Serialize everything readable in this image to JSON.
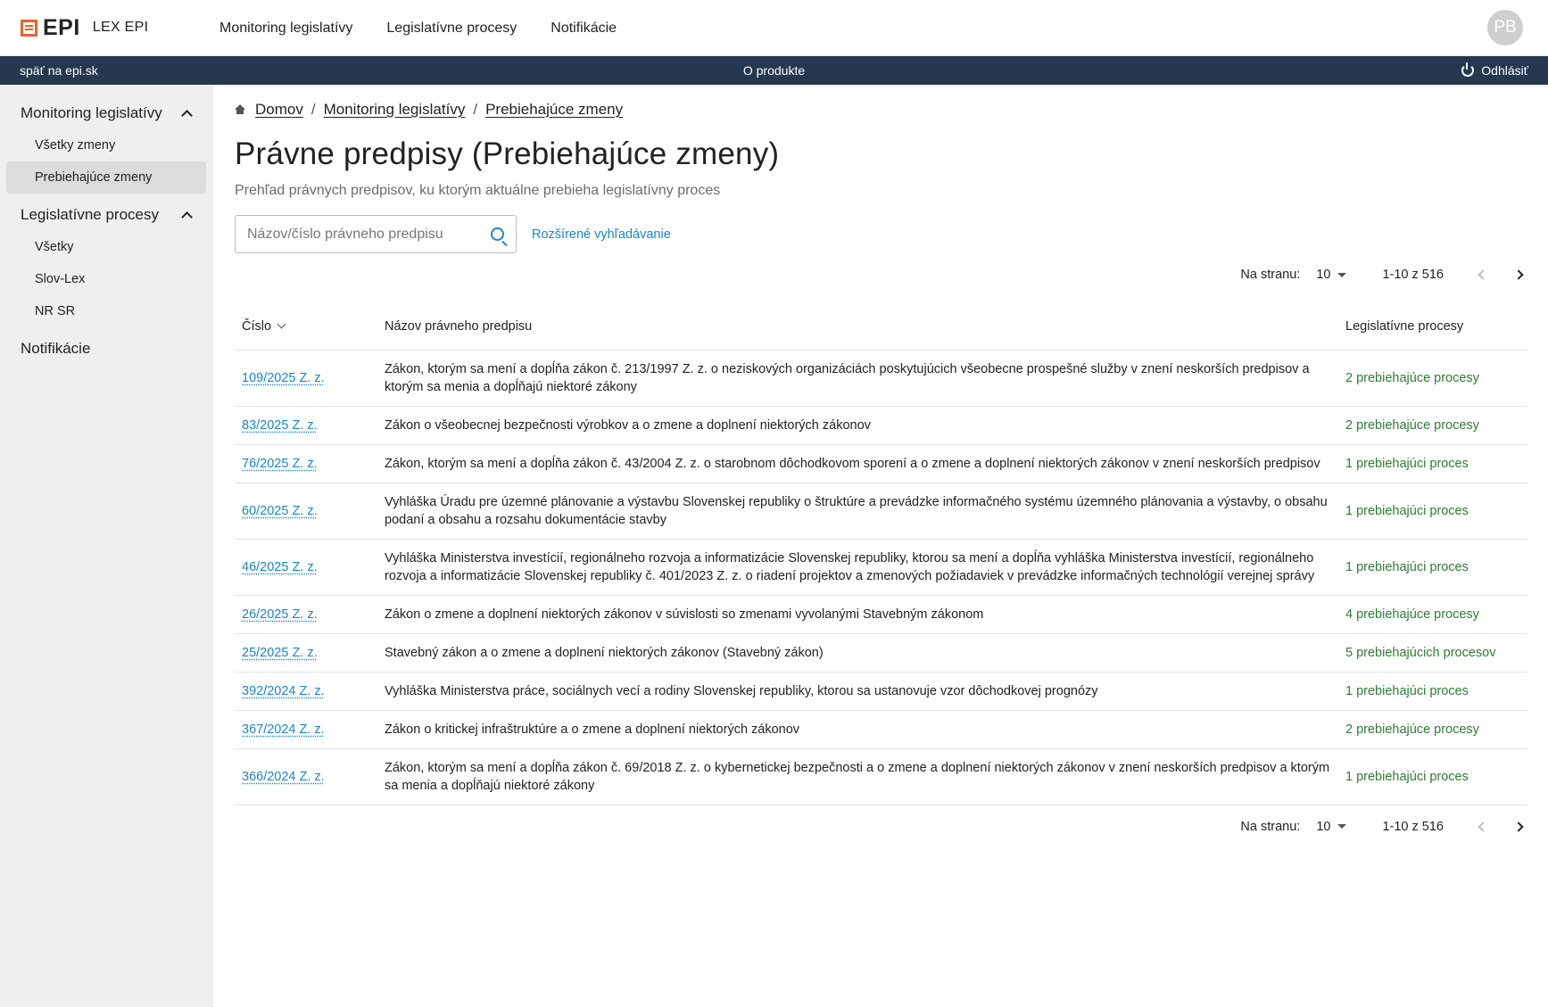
{
  "header": {
    "logo_text": "EPI",
    "product_name": "LEX EPI",
    "nav": [
      "Monitoring legislatívy",
      "Legislatívne procesy",
      "Notifikácie"
    ],
    "avatar_initials": "PB"
  },
  "subbar": {
    "back_link": "späť na epi.sk",
    "about": "O produkte",
    "logout": "Odhlásiť"
  },
  "sidebar": {
    "sections": [
      {
        "label": "Monitoring legislatívy",
        "items": [
          "Všetky zmeny",
          "Prebiehajúce zmeny"
        ]
      },
      {
        "label": "Legislatívne procesy",
        "items": [
          "Všetky",
          "Slov-Lex",
          "NR SR"
        ]
      },
      {
        "label": "Notifikácie",
        "items": []
      }
    ],
    "active_item": "Prebiehajúce zmeny"
  },
  "breadcrumb": [
    "Domov",
    "Monitoring legislatívy",
    "Prebiehajúce zmeny"
  ],
  "page": {
    "title": "Právne predpisy (Prebiehajúce zmeny)",
    "subtitle": "Prehľad právnych predpisov, ku ktorým aktuálne prebieha legislatívny proces"
  },
  "search": {
    "placeholder": "Názov/číslo právneho predpisu",
    "advanced_link": "Rozšírené vyhľadávanie"
  },
  "pagination": {
    "per_page_label": "Na stranu:",
    "per_page_value": "10",
    "range": "1-10 z 516"
  },
  "table": {
    "headers": [
      "Číslo",
      "Názov právneho predpisu",
      "Legislatívne procesy"
    ],
    "rows": [
      {
        "number": "109/2025 Z. z.",
        "title": "Zákon, ktorým sa mení a dopĺňa zákon č. 213/1997 Z. z. o neziskových organizáciách poskytujúcich všeobecne prospešné služby v znení neskorších predpisov a ktorým sa menia a dopĺňajú niektoré zákony",
        "processes": "2 prebiehajúce procesy"
      },
      {
        "number": "83/2025 Z. z.",
        "title": "Zákon o všeobecnej bezpečnosti výrobkov a o zmene a doplnení niektorých zákonov",
        "processes": "2 prebiehajúce procesy"
      },
      {
        "number": "76/2025 Z. z.",
        "title": "Zákon, ktorým sa mení a dopĺňa zákon č. 43/2004 Z. z. o starobnom dôchodkovom sporení a o zmene a doplnení niektorých zákonov v znení neskorších predpisov",
        "processes": "1 prebiehajúci proces"
      },
      {
        "number": "60/2025 Z. z.",
        "title": "Vyhláška Úradu pre územné plánovanie a výstavbu Slovenskej republiky o štruktúre a prevádzke informačného systému územného plánovania a výstavby, o obsahu podaní a obsahu a rozsahu dokumentácie stavby",
        "processes": "1 prebiehajúci proces"
      },
      {
        "number": "46/2025 Z. z.",
        "title": "Vyhláška Ministerstva investícií, regionálneho rozvoja a informatizácie Slovenskej republiky, ktorou sa mení a dopĺňa vyhláška Ministerstva investícií, regionálneho rozvoja a informatizácie Slovenskej republiky č. 401/2023 Z. z. o riadení projektov a zmenových požiadaviek v prevádzke informačných technológií verejnej správy",
        "processes": "1 prebiehajúci proces"
      },
      {
        "number": "26/2025 Z. z.",
        "title": "Zákon o zmene a doplnení niektorých zákonov v súvislosti so zmenami vyvolanými Stavebným zákonom",
        "processes": "4 prebiehajúce procesy"
      },
      {
        "number": "25/2025 Z. z.",
        "title": "Stavebný zákon a o zmene a doplnení niektorých zákonov (Stavebný zákon)",
        "processes": "5 prebiehajúcich procesov"
      },
      {
        "number": "392/2024 Z. z.",
        "title": "Vyhláška Ministerstva práce, sociálnych vecí a rodiny Slovenskej republiky, ktorou sa ustanovuje vzor dôchodkovej prognózy",
        "processes": "1 prebiehajúci proces"
      },
      {
        "number": "367/2024 Z. z.",
        "title": "Zákon o kritickej infraštruktúre a o zmene a doplnení niektorých zákonov",
        "processes": "2 prebiehajúce procesy"
      },
      {
        "number": "366/2024 Z. z.",
        "title": "Zákon, ktorým sa mení a dopĺňa zákon č. 69/2018 Z. z. o kybernetickej bezpečnosti a o zmene a doplnení niektorých zákonov v znení neskorších predpisov a ktorým sa menia a dopĺňajú niektoré zákony",
        "processes": "1 prebiehajúci proces"
      }
    ]
  },
  "colors": {
    "accent": "#1a86c7",
    "brand": "#e8632b",
    "subbar": "#26384f",
    "process": "#2e7d32"
  }
}
